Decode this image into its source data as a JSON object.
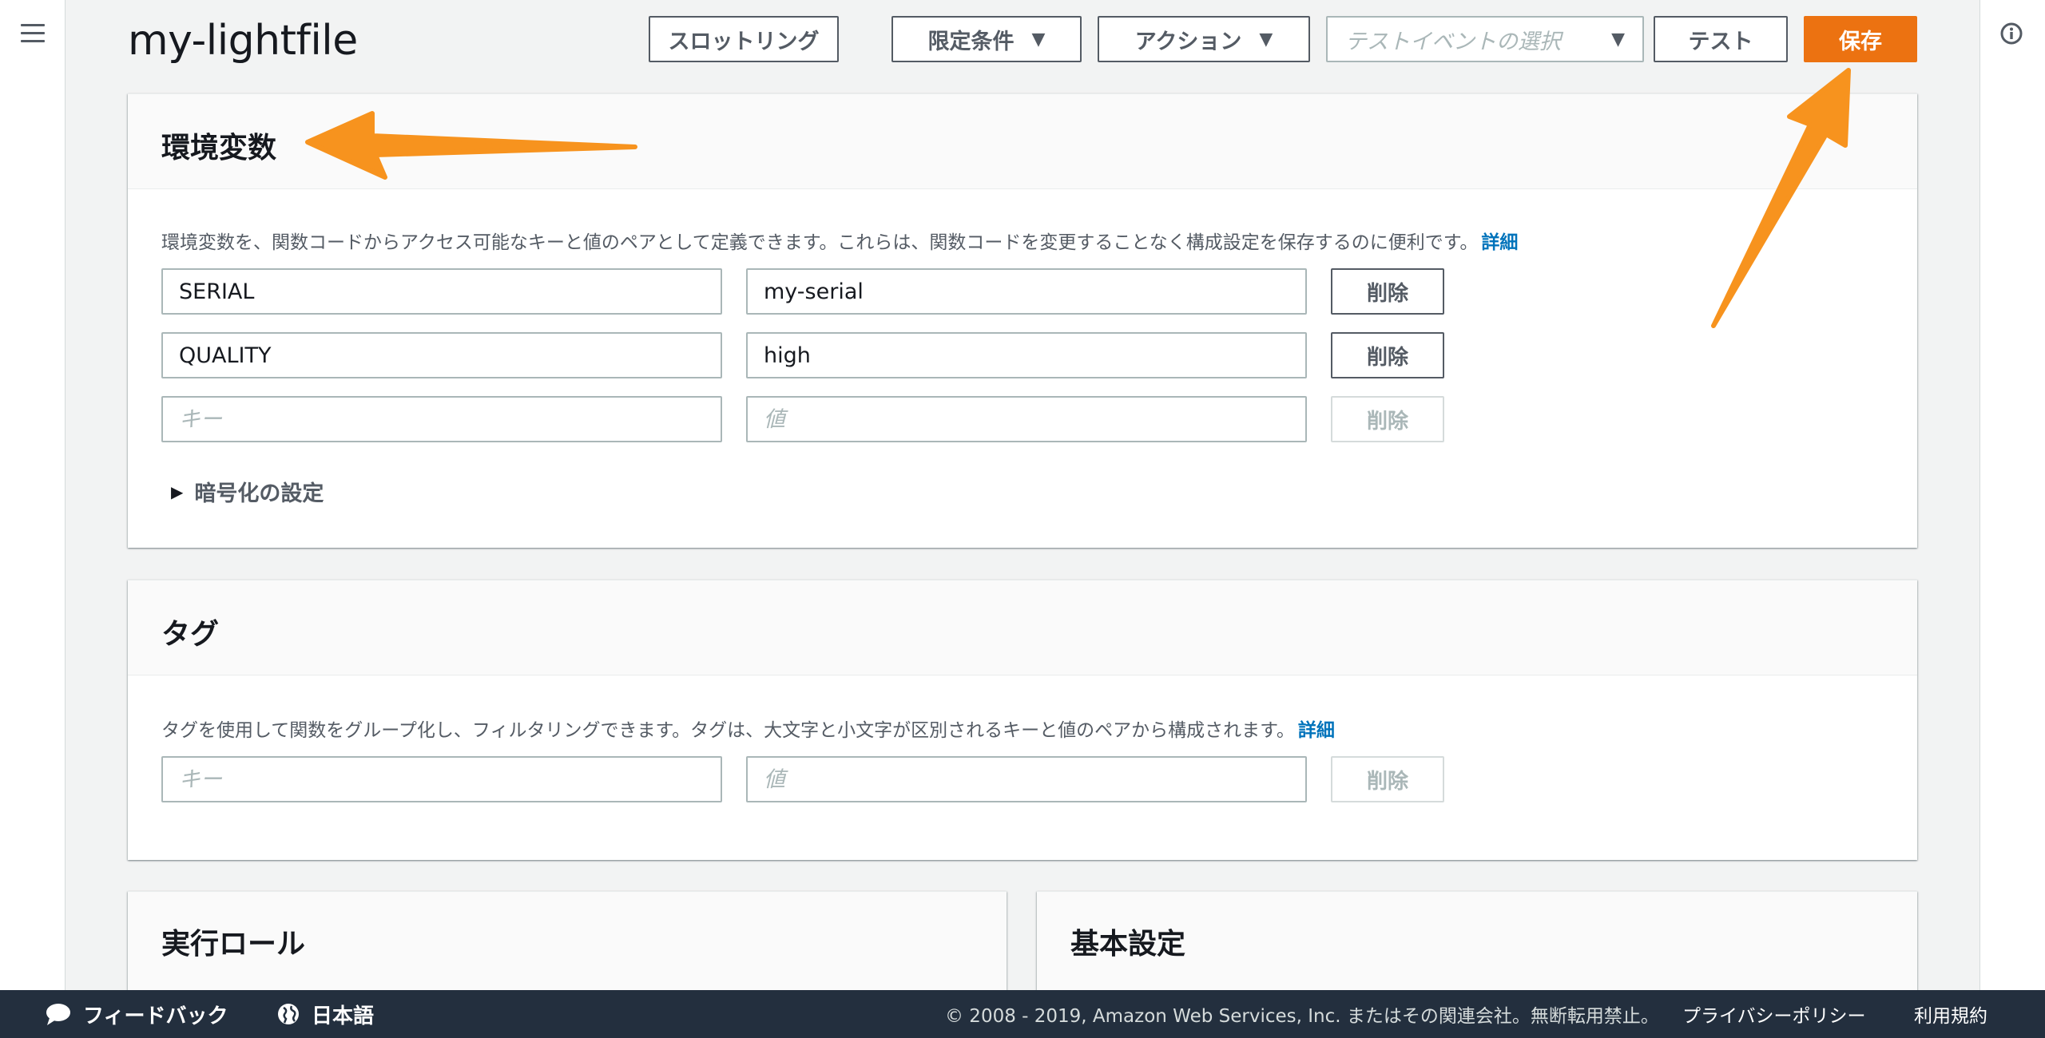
{
  "header": {
    "title": "my-lightfile",
    "throttle_label": "スロットリング",
    "qualifiers_label": "限定条件",
    "actions_label": "アクション",
    "test_event_placeholder": "テストイベントの選択",
    "test_label": "テスト",
    "save_label": "保存"
  },
  "env_vars": {
    "title": "環境変数",
    "description": "環境変数を、関数コードからアクセス可能なキーと値のペアとして定義できます。これらは、関数コードを変更することなく構成設定を保存するのに便利です。",
    "learn_more": "詳細",
    "rows": [
      {
        "key": "SERIAL",
        "value": "my-serial",
        "remove_label": "削除"
      },
      {
        "key": "QUALITY",
        "value": "high",
        "remove_label": "削除"
      }
    ],
    "new_row": {
      "key_placeholder": "キー",
      "value_placeholder": "値",
      "remove_label": "削除"
    },
    "encryption_label": "暗号化の設定"
  },
  "tags": {
    "title": "タグ",
    "description": "タグを使用して関数をグループ化し、フィルタリングできます。タグは、大文字と小文字が区別されるキーと値のペアから構成されます。",
    "learn_more": "詳細",
    "new_row": {
      "key_placeholder": "キー",
      "value_placeholder": "値",
      "remove_label": "削除"
    }
  },
  "execution_role": {
    "title": "実行ロール"
  },
  "basic_settings": {
    "title": "基本設定"
  },
  "footer": {
    "feedback_label": "フィードバック",
    "language_label": "日本語",
    "copyright": "© 2008 - 2019, Amazon Web Services, Inc. またはその関連会社。無断転用禁止。",
    "privacy_label": "プライバシーポリシー",
    "terms_label": "利用規約"
  },
  "colors": {
    "primary_button": "#ec7211",
    "link": "#0073bb",
    "footer_bg": "#232f3e",
    "annotation_arrow": "#f7931e"
  },
  "icons": [
    "menu-icon",
    "info-icon",
    "caret-down-icon",
    "caret-right-icon",
    "feedback-icon",
    "globe-icon"
  ]
}
